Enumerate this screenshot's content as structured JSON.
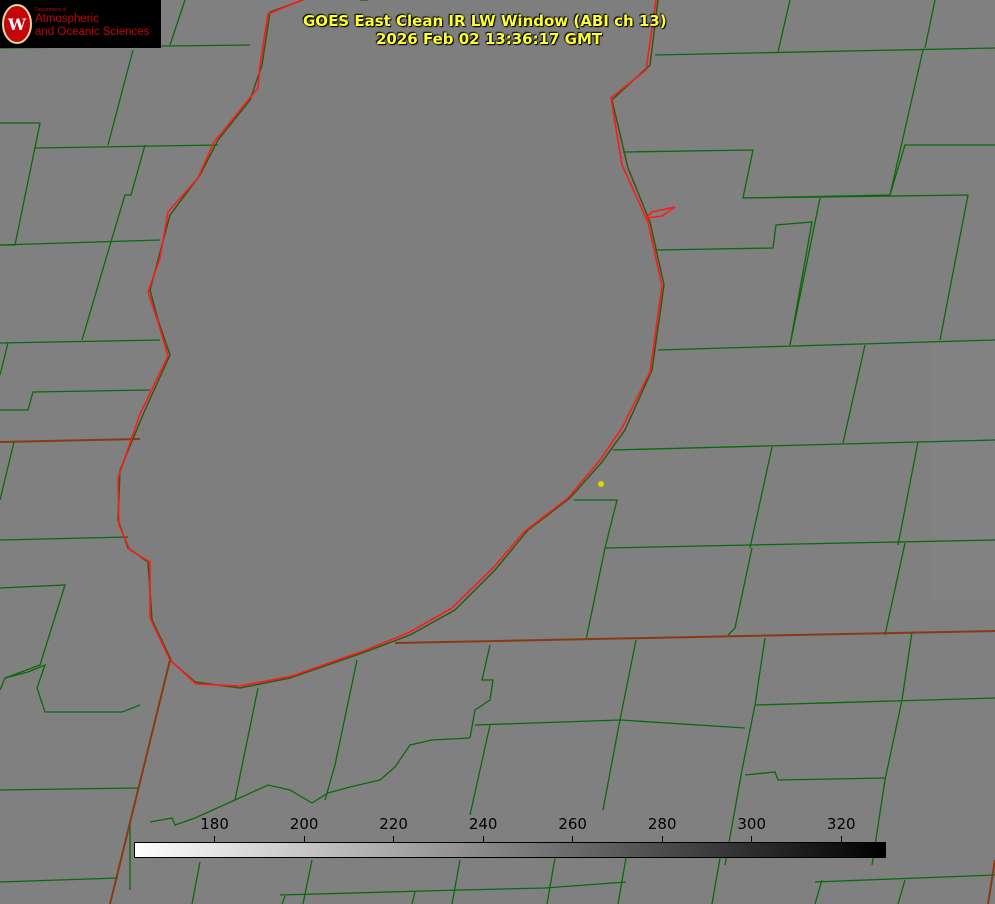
{
  "logo": {
    "department": "Department of",
    "line1": "Atmospheric",
    "line2": "and Oceanic Sciences"
  },
  "title": {
    "line1": "GOES East Clean IR LW Window (ABI ch 13)",
    "line2": "2026 Feb 02 13:36:17 GMT"
  },
  "colorbar": {
    "min": 162,
    "max": 330,
    "ticks": [
      "180",
      "200",
      "220",
      "240",
      "260",
      "280",
      "300",
      "320"
    ],
    "colors": {
      "low": "#ffffff",
      "high": "#000000"
    }
  },
  "colors": {
    "background": "#808080",
    "lake_fill": "#7e7e7e",
    "county_lines": "#0a6a0a",
    "coastline_red": "#ff1a1a",
    "state_border": "#7a4a10",
    "title_text": "#ffff33",
    "marker": "#d8d800"
  }
}
